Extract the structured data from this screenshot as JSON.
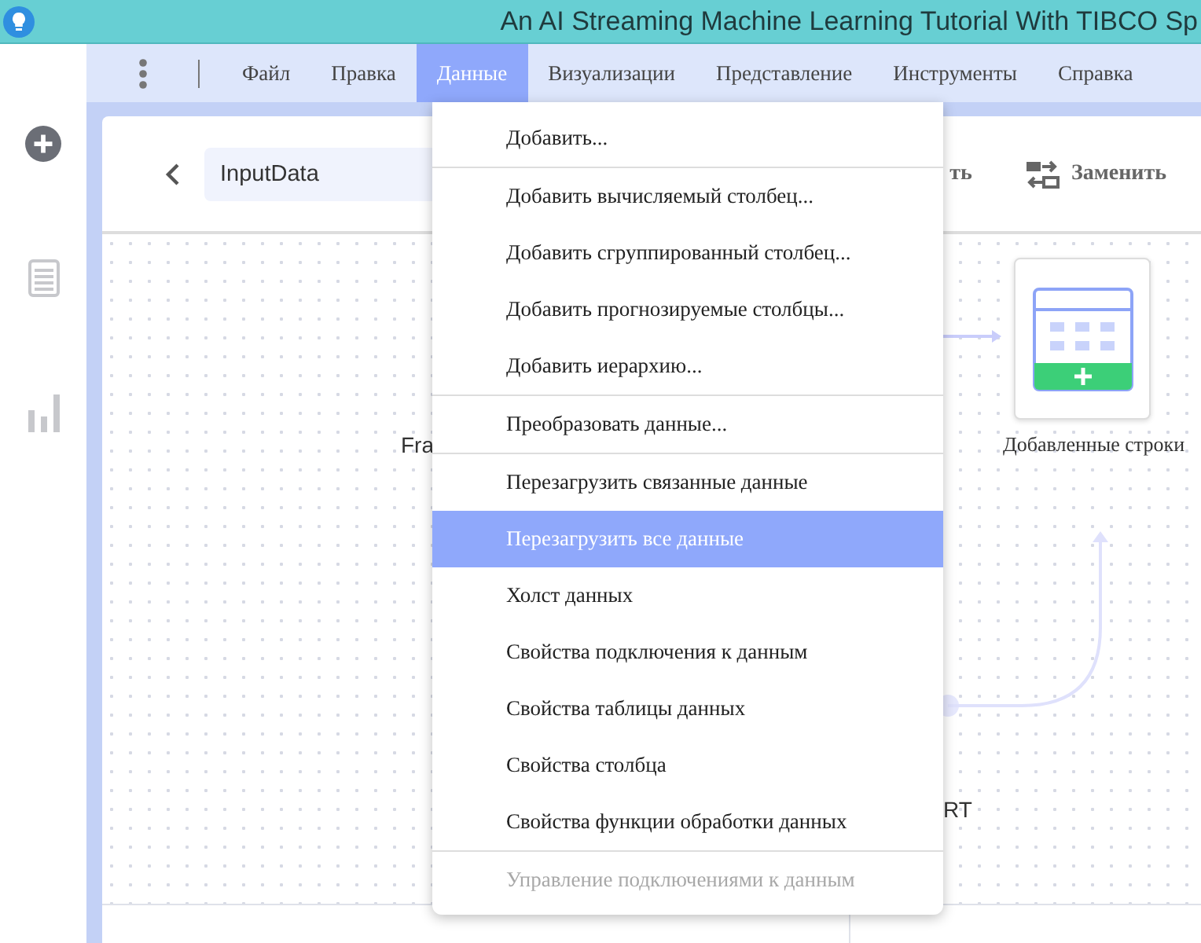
{
  "window": {
    "title": "An AI Streaming Machine Learning Tutorial With TIBCO Sp"
  },
  "menubar": {
    "items": [
      {
        "label": "Файл",
        "selected": false
      },
      {
        "label": "Правка",
        "selected": false
      },
      {
        "label": "Данные",
        "selected": true
      },
      {
        "label": "Визуализации",
        "selected": false
      },
      {
        "label": "Представление",
        "selected": false
      },
      {
        "label": "Инструменты",
        "selected": false
      },
      {
        "label": "Справка",
        "selected": false
      }
    ]
  },
  "header": {
    "field_value": "InputData",
    "partial_button": "ть",
    "replace_button": "Заменить"
  },
  "canvas": {
    "left_node_label": "Fra",
    "node_label": "Добавленные строки",
    "bottom_node_label": "RT"
  },
  "dropdown": {
    "groups": [
      [
        {
          "label": "Добавить...",
          "selected": false,
          "disabled": false
        }
      ],
      [
        {
          "label": "Добавить вычисляемый столбец...",
          "selected": false,
          "disabled": false
        },
        {
          "label": "Добавить сгруппированный столбец...",
          "selected": false,
          "disabled": false
        },
        {
          "label": "Добавить прогнозируемые столбцы...",
          "selected": false,
          "disabled": false
        },
        {
          "label": "Добавить иерархию...",
          "selected": false,
          "disabled": false
        }
      ],
      [
        {
          "label": "Преобразовать данные...",
          "selected": false,
          "disabled": false
        }
      ],
      [
        {
          "label": "Перезагрузить связанные данные",
          "selected": false,
          "disabled": false
        },
        {
          "label": "Перезагрузить все данные",
          "selected": true,
          "disabled": false
        },
        {
          "label": "Холст данных",
          "selected": false,
          "disabled": false
        },
        {
          "label": "Свойства подключения к данным",
          "selected": false,
          "disabled": false
        },
        {
          "label": "Свойства таблицы данных",
          "selected": false,
          "disabled": false
        },
        {
          "label": "Свойства столбца",
          "selected": false,
          "disabled": false
        },
        {
          "label": "Свойства функции обработки данных",
          "selected": false,
          "disabled": false
        }
      ],
      [
        {
          "label": "Управление подключениями к данным",
          "selected": false,
          "disabled": true
        }
      ]
    ]
  }
}
